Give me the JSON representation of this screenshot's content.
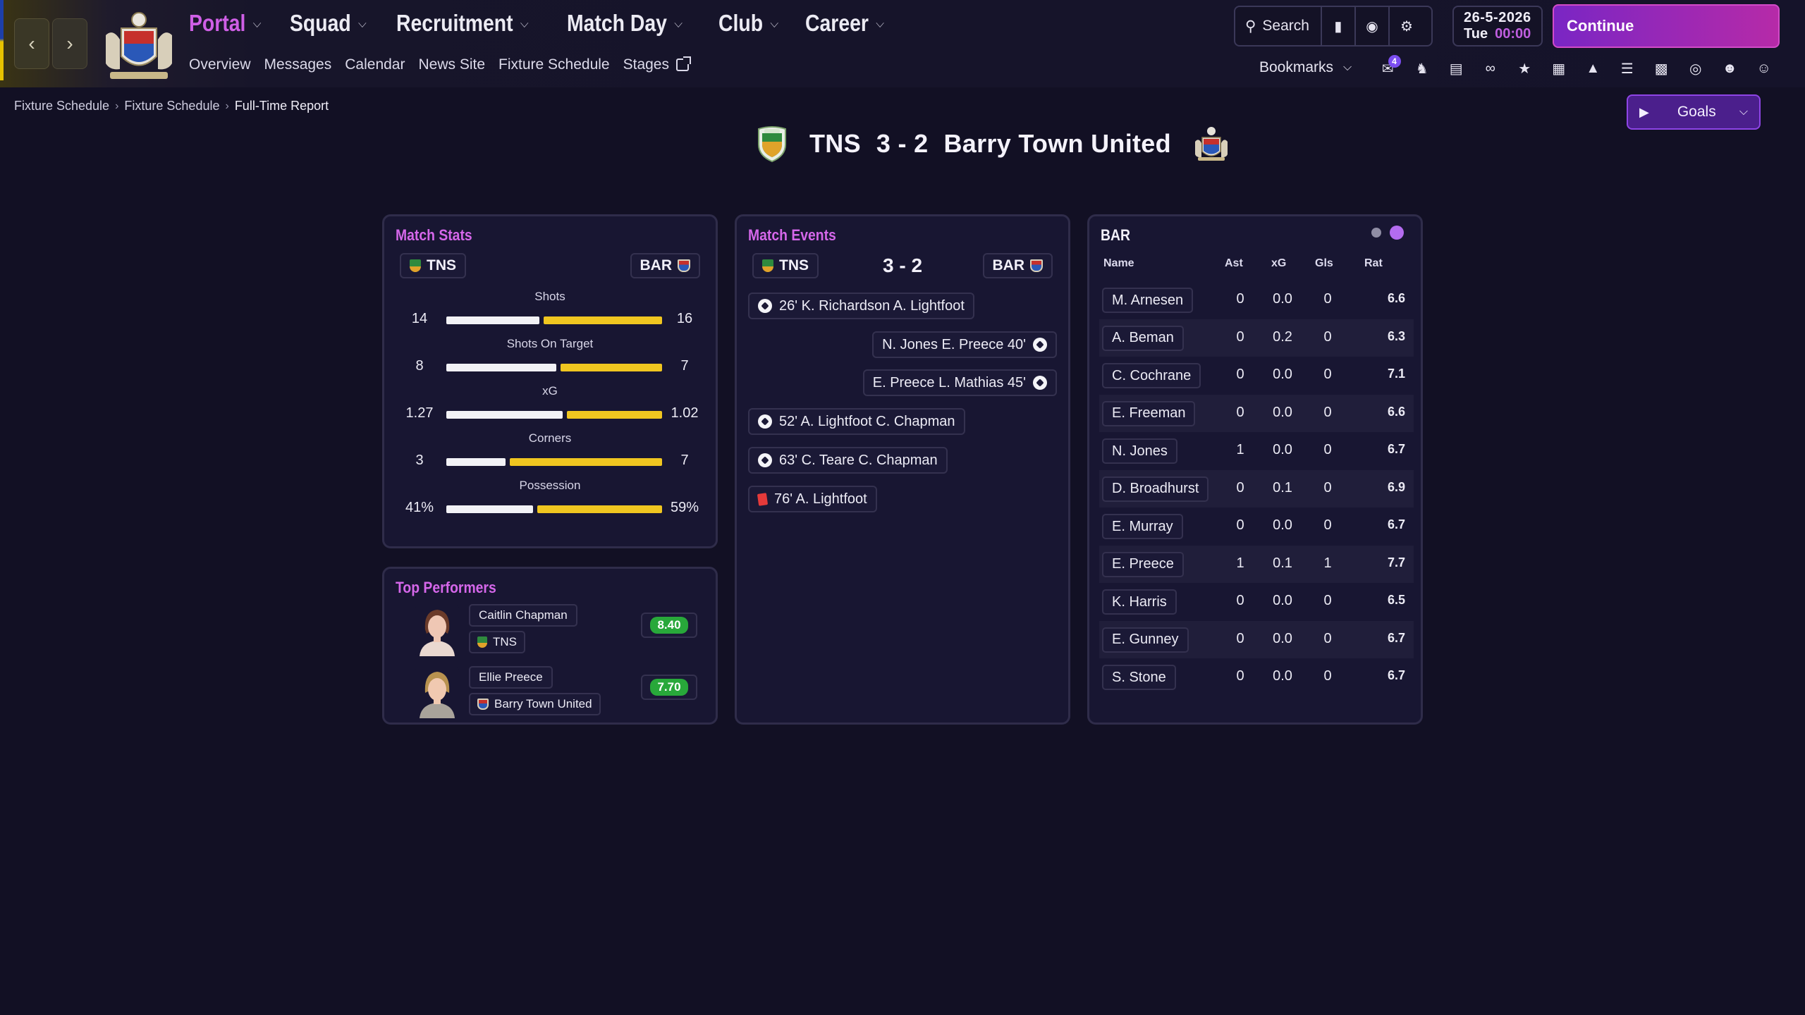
{
  "header": {
    "nav": [
      {
        "label": "Portal",
        "active": true
      },
      {
        "label": "Squad",
        "active": false
      },
      {
        "label": "Recruitment",
        "active": false
      },
      {
        "label": "Match Day",
        "active": false
      },
      {
        "label": "Club",
        "active": false
      },
      {
        "label": "Career",
        "active": false
      }
    ],
    "subnav": [
      "Overview",
      "Messages",
      "Calendar",
      "News Site",
      "Fixture Schedule",
      "Stages"
    ],
    "search_label": "Search",
    "date": "26-5-2026",
    "day": "Tue",
    "time": "00:00",
    "continue_label": "Continue",
    "bookmarks_label": "Bookmarks",
    "messages_badge": "4"
  },
  "breadcrumb": [
    "Fixture Schedule",
    "Fixture Schedule",
    "Full-Time Report"
  ],
  "goals_button": "Goals",
  "match": {
    "home": "TNS",
    "away": "Barry Town United",
    "score": "3 - 2",
    "home_short": "TNS",
    "away_short": "BAR"
  },
  "match_stats": {
    "title": "Match Stats",
    "stats": [
      {
        "label": "Shots",
        "home": "14",
        "away": "16",
        "home_share": 0.44
      },
      {
        "label": "Shots On Target",
        "home": "8",
        "away": "7",
        "home_share": 0.52
      },
      {
        "label": "xG",
        "home": "1.27",
        "away": "1.02",
        "home_share": 0.55
      },
      {
        "label": "Corners",
        "home": "3",
        "away": "7",
        "home_share": 0.28
      },
      {
        "label": "Possession",
        "home": "41%",
        "away": "59%",
        "home_share": 0.41
      }
    ]
  },
  "match_events": {
    "title": "Match Events",
    "score": "3 - 2",
    "events": [
      {
        "text": "26' K. Richardson A. Lightfoot",
        "side": "home",
        "type": "goal"
      },
      {
        "text": "N. Jones E. Preece 40'",
        "side": "away",
        "type": "goal"
      },
      {
        "text": "E. Preece L. Mathias 45'",
        "side": "away",
        "type": "goal"
      },
      {
        "text": "52' A. Lightfoot C. Chapman",
        "side": "home",
        "type": "goal"
      },
      {
        "text": "63' C. Teare C. Chapman",
        "side": "home",
        "type": "goal"
      },
      {
        "text": "76' A. Lightfoot",
        "side": "home",
        "type": "red-card"
      }
    ]
  },
  "top_performers": {
    "title": "Top Performers",
    "players": [
      {
        "name": "Caitlin Chapman",
        "team": "TNS",
        "rating": "8.40"
      },
      {
        "name": "Ellie Preece",
        "team": "Barry Town United",
        "rating": "7.70"
      }
    ]
  },
  "player_table": {
    "title": "BAR",
    "columns": [
      "Name",
      "Ast",
      "xG",
      "Gls",
      "Rat"
    ],
    "rows": [
      {
        "name": "M. Arnesen",
        "ast": "0",
        "xg": "0.0",
        "gls": "0",
        "rat": "6.6"
      },
      {
        "name": "A. Beman",
        "ast": "0",
        "xg": "0.2",
        "gls": "0",
        "rat": "6.3"
      },
      {
        "name": "C. Cochrane",
        "ast": "0",
        "xg": "0.0",
        "gls": "0",
        "rat": "7.1"
      },
      {
        "name": "E. Freeman",
        "ast": "0",
        "xg": "0.0",
        "gls": "0",
        "rat": "6.6"
      },
      {
        "name": "N. Jones",
        "ast": "1",
        "xg": "0.0",
        "gls": "0",
        "rat": "6.7"
      },
      {
        "name": "D. Broadhurst",
        "ast": "0",
        "xg": "0.1",
        "gls": "0",
        "rat": "6.9"
      },
      {
        "name": "E. Murray",
        "ast": "0",
        "xg": "0.0",
        "gls": "0",
        "rat": "6.7"
      },
      {
        "name": "E. Preece",
        "ast": "1",
        "xg": "0.1",
        "gls": "1",
        "rat": "7.7"
      },
      {
        "name": "K. Harris",
        "ast": "0",
        "xg": "0.0",
        "gls": "0",
        "rat": "6.5"
      },
      {
        "name": "E. Gunney",
        "ast": "0",
        "xg": "0.0",
        "gls": "0",
        "rat": "6.7"
      },
      {
        "name": "S. Stone",
        "ast": "0",
        "xg": "0.0",
        "gls": "0",
        "rat": "6.7"
      }
    ]
  },
  "colors": {
    "accent": "#cf5fe6",
    "home_bar": "#f2f2f6",
    "away_bar": "#f0c620",
    "rating_good": "#28a83a",
    "red_card": "#e53a3a"
  }
}
